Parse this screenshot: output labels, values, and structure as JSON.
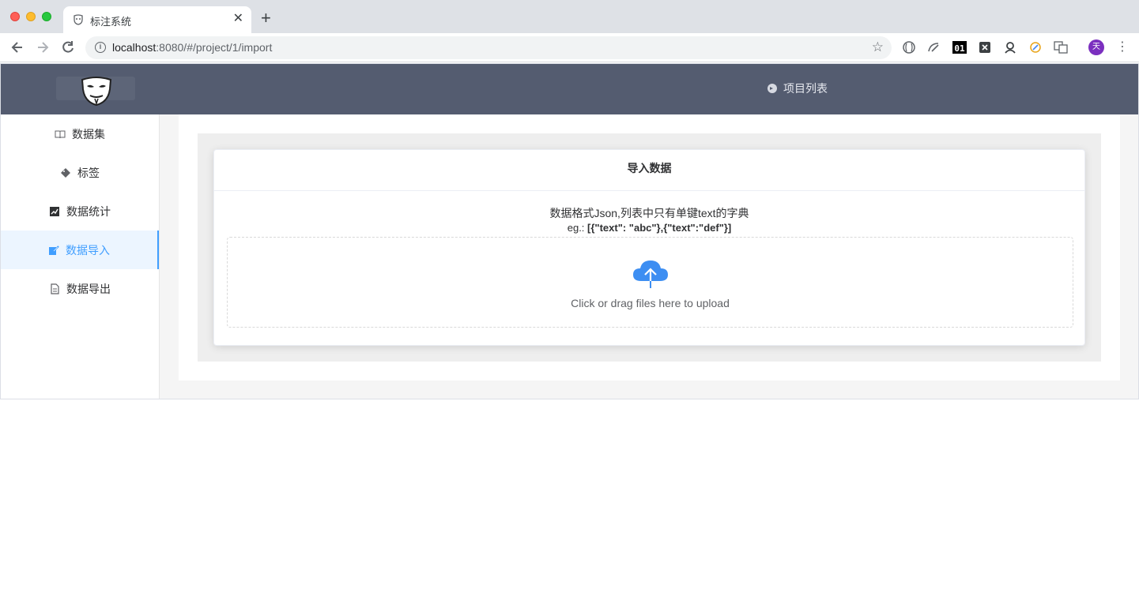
{
  "browser": {
    "tab_title": "标注系统",
    "tab_close": "✕",
    "new_tab": "+",
    "url_host": "localhost",
    "url_rest": ":8080/#/project/1/import",
    "avatar_letter": "天",
    "extensions": [
      "globe-ext-icon",
      "speedometer-ext-icon",
      "01-ext-icon",
      "x-ext-icon",
      "r-ext-icon",
      "compass-ext-icon",
      "translate-ext-icon"
    ]
  },
  "header": {
    "nav_label": "项目列表"
  },
  "sidebar": {
    "items": [
      {
        "label": "数据集",
        "icon": "book-icon",
        "active": false
      },
      {
        "label": "标签",
        "icon": "tag-icon",
        "active": false
      },
      {
        "label": "数据统计",
        "icon": "chart-icon",
        "active": false
      },
      {
        "label": "数据导入",
        "icon": "edit-icon",
        "active": true
      },
      {
        "label": "数据导出",
        "icon": "document-icon",
        "active": false
      }
    ]
  },
  "card": {
    "title": "导入数据",
    "description": "数据格式Json,列表中只有单键text的字典",
    "example_prefix": "eg.: ",
    "example_code": "[{\"text\": \"abc\"},{\"text\":\"def\"}]",
    "upload_text": "Click or drag files here to upload"
  },
  "colors": {
    "header_bg": "#545c70",
    "active": "#409eff",
    "cloud": "#3d8ef2"
  }
}
